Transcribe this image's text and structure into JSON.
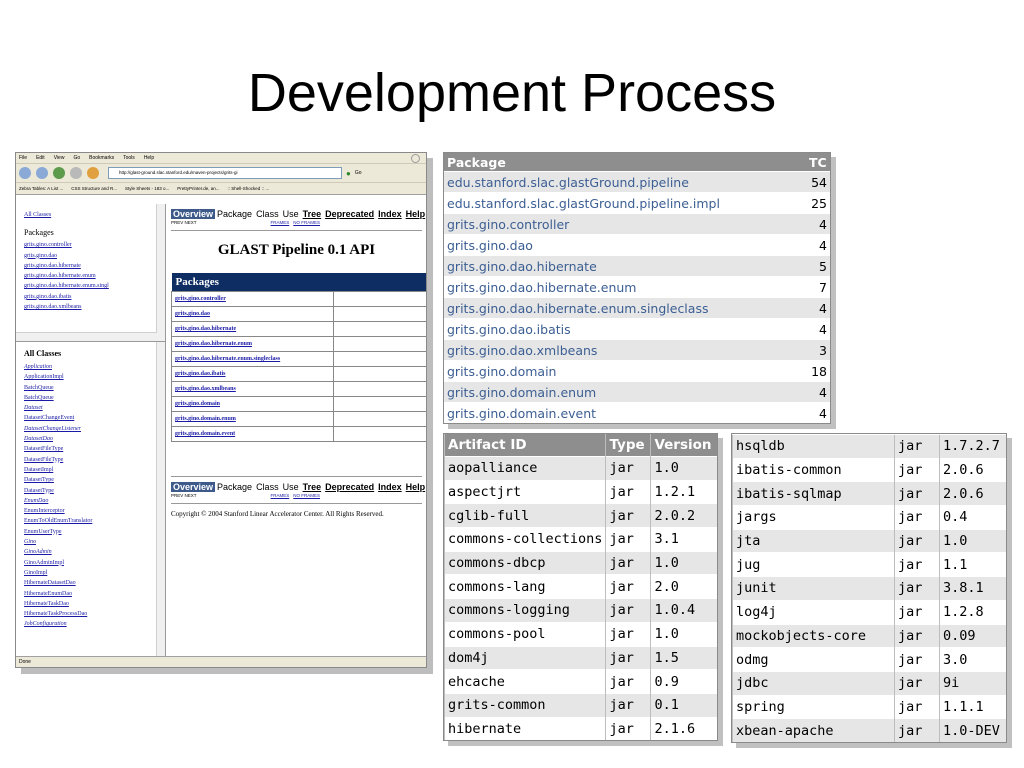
{
  "slide": {
    "title": "Development Process"
  },
  "browser": {
    "menu": [
      "File",
      "Edit",
      "View",
      "Go",
      "Bookmarks",
      "Tools",
      "Help"
    ],
    "url": "http://glast-ground.slac.stanford.edu/maven-projects/grits-gi",
    "go_label": "Go",
    "bookmarks": [
      "Zebra Tables: A List ...",
      "CSS Structure and R...",
      "Style Sheets - 183 o...",
      "PrettyPrinter.de, an...",
      ":: Shell-Shocked :: ..."
    ],
    "status": "Done",
    "left_top": {
      "all_classes": "All Classes",
      "packages_heading": "Packages",
      "packages": [
        "grits.gino.controller",
        "grits.gino.dao",
        "grits.gino.dao.hibernate",
        "grits.gino.dao.hibernate.enum",
        "grits.gino.dao.hibernate.enum.singl",
        "grits.gino.dao.ibatis",
        "grits.gino.dao.xmlbeans"
      ]
    },
    "left_bottom": {
      "heading": "All Classes",
      "classes": [
        {
          "name": "Application",
          "italic": true
        },
        {
          "name": "ApplicationImpl",
          "italic": false
        },
        {
          "name": "BatchQueue",
          "italic": false
        },
        {
          "name": "BatchQueue",
          "italic": false
        },
        {
          "name": "Dataset",
          "italic": true
        },
        {
          "name": "DatasetChangeEvent",
          "italic": false
        },
        {
          "name": "DatasetChangeListener",
          "italic": true
        },
        {
          "name": "DatasetDao",
          "italic": true
        },
        {
          "name": "DatasetFileType",
          "italic": false
        },
        {
          "name": "DatasetFileType",
          "italic": false
        },
        {
          "name": "DatasetImpl",
          "italic": false
        },
        {
          "name": "DatasetType",
          "italic": false
        },
        {
          "name": "DatasetType",
          "italic": false
        },
        {
          "name": "EnumDao",
          "italic": true
        },
        {
          "name": "EnumInterceptor",
          "italic": false
        },
        {
          "name": "EnumToOldEnumTranslator",
          "italic": false
        },
        {
          "name": "EnumUserType",
          "italic": false
        },
        {
          "name": "Gino",
          "italic": true
        },
        {
          "name": "GinoAdmin",
          "italic": true
        },
        {
          "name": "GinoAdminImpl",
          "italic": false
        },
        {
          "name": "GinoImpl",
          "italic": false
        },
        {
          "name": "HibernateDatasetDao",
          "italic": false
        },
        {
          "name": "HibernateEnumDao",
          "italic": false
        },
        {
          "name": "HibernateTaskDao",
          "italic": false
        },
        {
          "name": "HibernateTaskProcessDao",
          "italic": false
        },
        {
          "name": "JobConfiguration",
          "italic": true
        }
      ]
    },
    "main": {
      "nav": {
        "overview": "Overview",
        "package": "Package",
        "class": "Class",
        "use": "Use",
        "tree": "Tree",
        "deprecated": "Deprecated",
        "index": "Index",
        "help": "Help"
      },
      "prev_next": "PREV  NEXT",
      "frames": "FRAMES",
      "no_frames": "NO FRAMES",
      "title": "GLAST Pipeline 0.1 API",
      "packages_heading": "Packages",
      "packages": [
        "grits.gino.controller",
        "grits.gino.dao",
        "grits.gino.dao.hibernate",
        "grits.gino.dao.hibernate.enum",
        "grits.gino.dao.hibernate.enum.singleclass",
        "grits.gino.dao.ibatis",
        "grits.gino.dao.xmlbeans",
        "grits.gino.domain",
        "grits.gino.domain.enum",
        "grits.gino.domain.event"
      ],
      "copyright": "Copyright © 2004 Stanford Linear Accelerator Center. All Rights Reserved."
    }
  },
  "package_table": {
    "headers": [
      "Package",
      "TC"
    ],
    "rows": [
      [
        "edu.stanford.slac.glastGround.pipeline",
        "54"
      ],
      [
        "edu.stanford.slac.glastGround.pipeline.impl",
        "25"
      ],
      [
        "grits.gino.controller",
        "4"
      ],
      [
        "grits.gino.dao",
        "4"
      ],
      [
        "grits.gino.dao.hibernate",
        "5"
      ],
      [
        "grits.gino.dao.hibernate.enum",
        "7"
      ],
      [
        "grits.gino.dao.hibernate.enum.singleclass",
        "4"
      ],
      [
        "grits.gino.dao.ibatis",
        "4"
      ],
      [
        "grits.gino.dao.xmlbeans",
        "3"
      ],
      [
        "grits.gino.domain",
        "18"
      ],
      [
        "grits.gino.domain.enum",
        "4"
      ],
      [
        "grits.gino.domain.event",
        "4"
      ]
    ]
  },
  "artifact_table_1": {
    "headers": [
      "Artifact ID",
      "Type",
      "Version"
    ],
    "rows": [
      [
        "aopalliance",
        "jar",
        "1.0"
      ],
      [
        "aspectjrt",
        "jar",
        "1.2.1"
      ],
      [
        "cglib-full",
        "jar",
        "2.0.2"
      ],
      [
        "commons-collections",
        "jar",
        "3.1"
      ],
      [
        "commons-dbcp",
        "jar",
        "1.0"
      ],
      [
        "commons-lang",
        "jar",
        "2.0"
      ],
      [
        "commons-logging",
        "jar",
        "1.0.4"
      ],
      [
        "commons-pool",
        "jar",
        "1.0"
      ],
      [
        "dom4j",
        "jar",
        "1.5"
      ],
      [
        "ehcache",
        "jar",
        "0.9"
      ],
      [
        "grits-common",
        "jar",
        "0.1"
      ],
      [
        "hibernate",
        "jar",
        "2.1.6"
      ]
    ]
  },
  "artifact_table_2": {
    "rows": [
      [
        "hsqldb",
        "jar",
        "1.7.2.7"
      ],
      [
        "ibatis-common",
        "jar",
        "2.0.6"
      ],
      [
        "ibatis-sqlmap",
        "jar",
        "2.0.6"
      ],
      [
        "jargs",
        "jar",
        "0.4"
      ],
      [
        "jta",
        "jar",
        "1.0"
      ],
      [
        "jug",
        "jar",
        "1.1"
      ],
      [
        "junit",
        "jar",
        "3.8.1"
      ],
      [
        "log4j",
        "jar",
        "1.2.8"
      ],
      [
        "mockobjects-core",
        "jar",
        "0.09"
      ],
      [
        "odmg",
        "jar",
        "3.0"
      ],
      [
        "jdbc",
        "jar",
        "9i"
      ],
      [
        "spring",
        "jar",
        "1.1.1"
      ],
      [
        "xbean-apache",
        "jar",
        "1.0-DEV"
      ]
    ]
  }
}
